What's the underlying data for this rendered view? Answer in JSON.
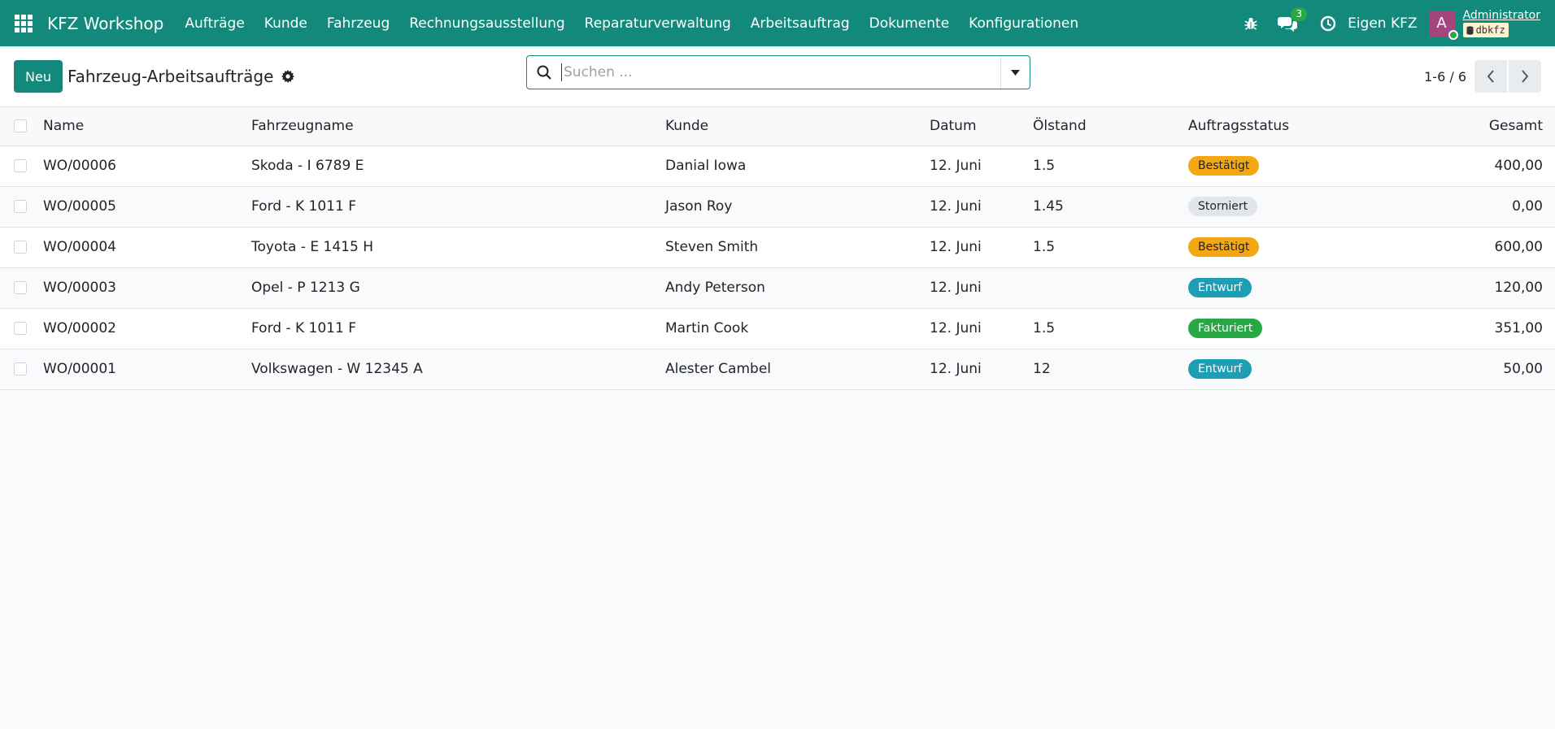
{
  "navbar": {
    "brand": "KFZ Workshop",
    "menu": [
      "Aufträge",
      "Kunde",
      "Fahrzeug",
      "Rechnungsausstellung",
      "Reparaturverwaltung",
      "Arbeitsauftrag",
      "Dokumente",
      "Konfigurationen"
    ],
    "chat_count": "3",
    "company": "Eigen KFZ",
    "avatar_letter": "A",
    "user_name": "Administrator",
    "db_name": "dbkfz"
  },
  "control": {
    "new_label": "Neu",
    "title": "Fahrzeug-Arbeitsaufträge",
    "search_placeholder": "Suchen ...",
    "pager": "1-6 / 6"
  },
  "table": {
    "headers": [
      "Name",
      "Fahrzeugname",
      "Kunde",
      "Datum",
      "Ölstand",
      "Auftragsstatus",
      "Gesamt"
    ],
    "rows": [
      {
        "name": "WO/00006",
        "vehicle": "Skoda - I 6789 E",
        "customer": "Danial Iowa",
        "date": "12. Juni",
        "oil": "1.5",
        "status": "Bestätigt",
        "total": "400,00"
      },
      {
        "name": "WO/00005",
        "vehicle": "Ford - K 1011 F",
        "customer": "Jason Roy",
        "date": "12. Juni",
        "oil": "1.45",
        "status": "Storniert",
        "total": "0,00"
      },
      {
        "name": "WO/00004",
        "vehicle": "Toyota - E 1415 H",
        "customer": "Steven Smith",
        "date": "12. Juni",
        "oil": "1.5",
        "status": "Bestätigt",
        "total": "600,00"
      },
      {
        "name": "WO/00003",
        "vehicle": "Opel - P 1213 G",
        "customer": "Andy Peterson",
        "date": "12. Juni",
        "oil": "",
        "status": "Entwurf",
        "total": "120,00"
      },
      {
        "name": "WO/00002",
        "vehicle": "Ford - K 1011 F",
        "customer": "Martin Cook",
        "date": "12. Juni",
        "oil": "1.5",
        "status": "Fakturiert",
        "total": "351,00"
      },
      {
        "name": "WO/00001",
        "vehicle": "Volkswagen - W 12345 A",
        "customer": "Alester Cambel",
        "date": "12. Juni",
        "oil": "12",
        "status": "Entwurf",
        "total": "50,00"
      }
    ]
  },
  "status_colors": {
    "Bestätigt": {
      "bg": "#f3a712",
      "fg": "#212529"
    },
    "Storniert": {
      "bg": "#e2e5e9",
      "fg": "#212529"
    },
    "Entwurf": {
      "bg": "#1c9eb5",
      "fg": "#ffffff"
    },
    "Fakturiert": {
      "bg": "#28a745",
      "fg": "#ffffff"
    }
  },
  "colors": {
    "brand": "#12897b"
  }
}
